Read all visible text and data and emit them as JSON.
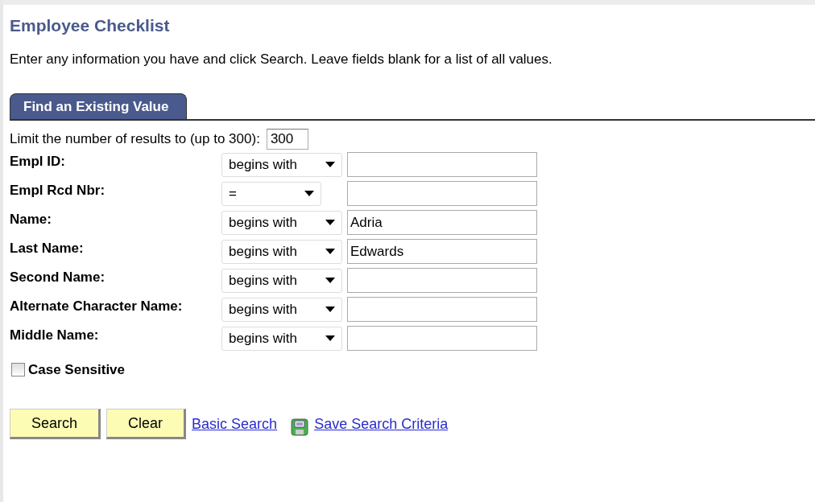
{
  "page": {
    "title": "Employee Checklist",
    "instructions": "Enter any information you have and click Search. Leave fields blank for a list of all values."
  },
  "tabs": [
    {
      "label": "Find an Existing Value",
      "selected": true
    }
  ],
  "limit": {
    "label": "Limit the number of results to (up to 300):",
    "value": "300"
  },
  "criteria": [
    {
      "label": "Empl ID:",
      "operator": "begins with"
    },
    {
      "label": "Empl Rcd Nbr:",
      "operator": "="
    },
    {
      "label": "Name:",
      "operator": "begins with",
      "value": "Adria"
    },
    {
      "label": "Last Name:",
      "operator": "begins with",
      "value": "Edwards"
    },
    {
      "label": "Second Name:",
      "operator": "begins with"
    },
    {
      "label": "Alternate Character Name:",
      "operator": "begins with"
    },
    {
      "label": "Middle Name:",
      "operator": "begins with"
    }
  ],
  "case_sensitive": {
    "label": "Case Sensitive",
    "checked": false
  },
  "actions": [
    {
      "kind": "button",
      "label": "Search"
    },
    {
      "kind": "button",
      "label": "Clear"
    },
    {
      "kind": "link",
      "label": "Basic Search"
    },
    {
      "kind": "save-link",
      "label": "Save Search Criteria"
    }
  ]
}
